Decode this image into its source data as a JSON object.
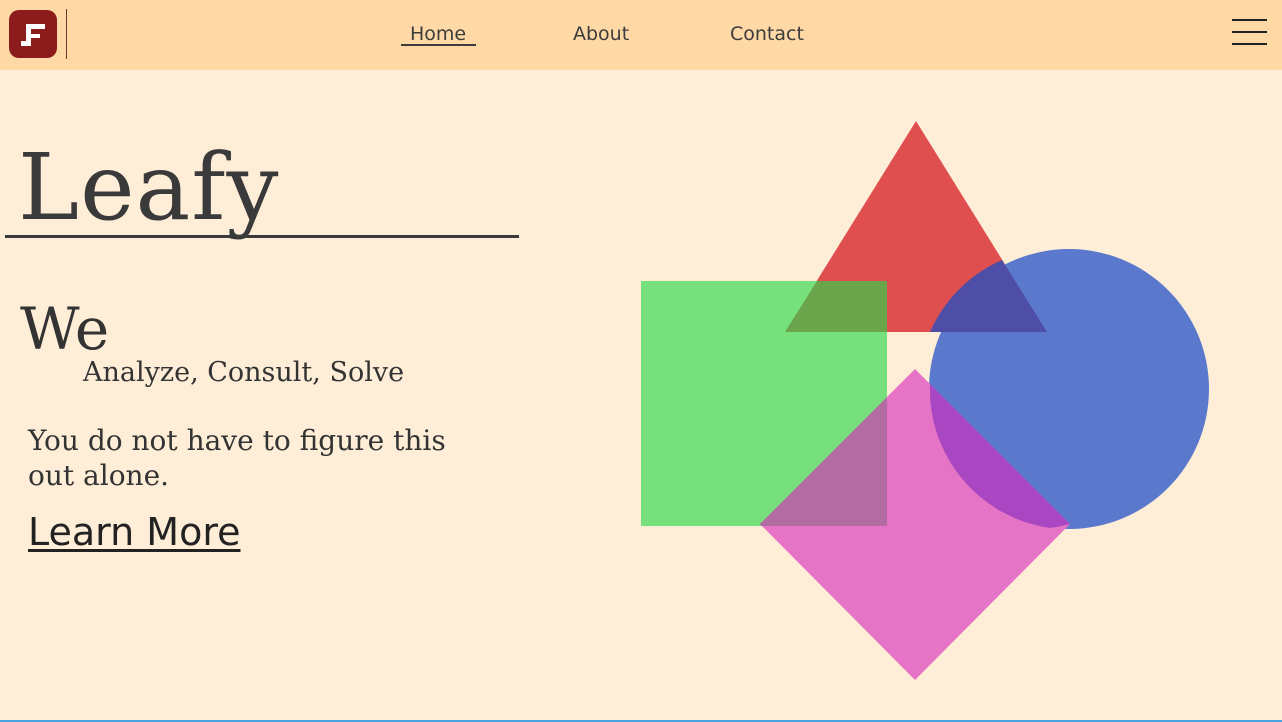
{
  "nav": {
    "logo_letter": "F",
    "links": [
      {
        "label": "Home",
        "active": true
      },
      {
        "label": "About",
        "active": false
      },
      {
        "label": "Contact",
        "active": false
      }
    ],
    "menu_icon": "hamburger-menu-icon"
  },
  "hero": {
    "title": "Leafy",
    "we": "We",
    "services": "Analyze, Consult, Solve",
    "tagline": "You do not have to figure this out alone.",
    "cta_label": "Learn More"
  },
  "shapes": {
    "triangle_color": "#e04f4f",
    "square_color": "#76e07d",
    "circle_color": "#5b79cc",
    "diamond_color": "#e674c6",
    "overlap_triangle_square": "#6aa44b",
    "overlap_triangle_circle": "#4f4ea6",
    "overlap_square_diamond": "#b26ca2",
    "overlap_circle_diamond": "#a946c1"
  },
  "colors": {
    "navbar_bg": "#fed9a6",
    "page_bg": "#feeed8",
    "logo_bg": "#8c1b1b",
    "text": "#3a3a3a"
  }
}
